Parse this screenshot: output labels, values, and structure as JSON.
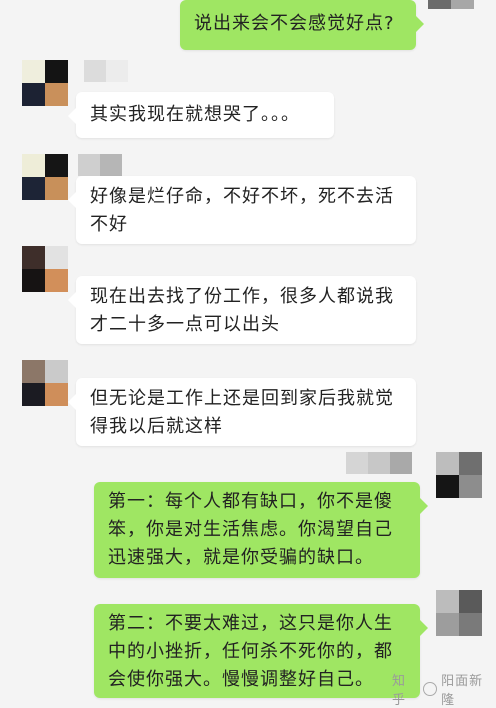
{
  "messages": [
    {
      "side": "out",
      "text": "说出来会不会感觉好点?"
    },
    {
      "side": "in",
      "text": "其实我现在就想哭了。。。"
    },
    {
      "side": "in",
      "text": "好像是烂仔命，不好不坏，死不去活不好"
    },
    {
      "side": "in",
      "text": "现在出去找了份工作，很多人都说我才二十多一点可以出头"
    },
    {
      "side": "in",
      "text": "但无论是工作上还是回到家后我就觉得我以后就这样"
    },
    {
      "side": "out",
      "text": "第一：每个人都有缺口，你不是傻笨，你是对生活焦虑。你渴望自己迅速强大，就是你受骗的缺口。"
    },
    {
      "side": "out",
      "text": "第二：不要太难过，这只是你人生中的小挫折，任何杀不死你的，都会使你强大。慢慢调整好自己。"
    }
  ],
  "watermark": {
    "site": "知乎",
    "author": "阳面新隆"
  },
  "colors": {
    "bubble_out": "#9fe663",
    "bubble_in": "#ffffff",
    "background": "#f4f4f4"
  }
}
